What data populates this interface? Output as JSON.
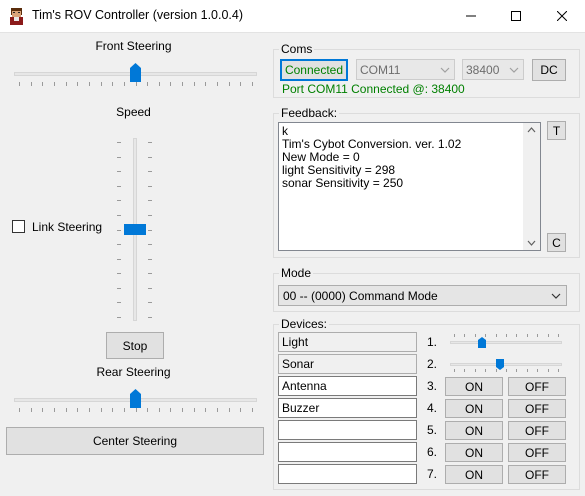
{
  "window": {
    "title": "Tim's ROV Controller (version 1.0.0.4)"
  },
  "steering": {
    "front_label": "Front Steering",
    "front_value": 0.5,
    "speed_label": "Speed",
    "speed_value": 0.5,
    "link_label": "Link Steering",
    "link_checked": false,
    "stop_label": "Stop",
    "rear_label": "Rear Steering",
    "rear_value": 0.5,
    "center_label": "Center Steering"
  },
  "coms": {
    "label": "Coms",
    "connect_label": "Connected",
    "port": "COM11",
    "baud": "38400",
    "dc_label": "DC",
    "status": "Port COM11 Connected @: 38400",
    "status_color": "#008000"
  },
  "feedback": {
    "label": "Feedback:",
    "lines": [
      "k",
      "Tim's Cybot Conversion. ver. 1.02",
      "New Mode = 0",
      "light Sensitivity = 298",
      "sonar Sensitivity = 250"
    ],
    "t_label": "T",
    "c_label": "C"
  },
  "mode": {
    "label": "Mode",
    "selected": "00 -- (0000) Command Mode"
  },
  "devices": {
    "label": "Devices:",
    "rows": [
      {
        "num": "1.",
        "name": "Light",
        "kind": "slider",
        "level": 0.27
      },
      {
        "num": "2.",
        "name": "Sonar",
        "kind": "slider",
        "level": 0.44
      },
      {
        "num": "3.",
        "name": "Antenna",
        "kind": "buttons",
        "on": "ON",
        "off": "OFF"
      },
      {
        "num": "4.",
        "name": "Buzzer",
        "kind": "buttons",
        "on": "ON",
        "off": "OFF"
      },
      {
        "num": "5.",
        "name": "",
        "kind": "buttons",
        "on": "ON",
        "off": "OFF"
      },
      {
        "num": "6.",
        "name": "",
        "kind": "buttons",
        "on": "ON",
        "off": "OFF"
      },
      {
        "num": "7.",
        "name": "",
        "kind": "buttons",
        "on": "ON",
        "off": "OFF"
      }
    ]
  },
  "colors": {
    "accent": "#0078d7",
    "connected_border": "#0078d7"
  }
}
